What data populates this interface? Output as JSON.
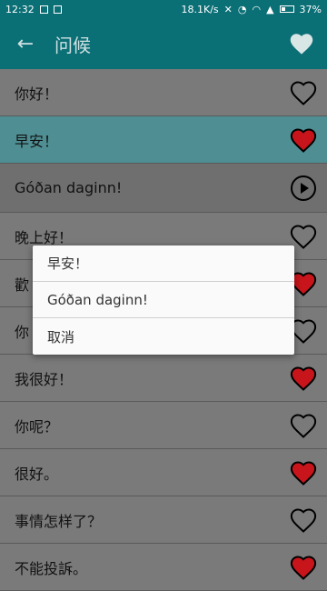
{
  "status": {
    "time": "12:32",
    "speed": "18.1K/s",
    "battery": "37%"
  },
  "appbar": {
    "title": "问候"
  },
  "rows": [
    {
      "text": "你好！",
      "icon": "heart-outline"
    },
    {
      "text": "早安！",
      "icon": "heart-filled"
    },
    {
      "text": "Góðan daginn!",
      "icon": "play-circle"
    },
    {
      "text": "晚上好！",
      "icon": "heart-outline"
    },
    {
      "text": "歡",
      "icon": "heart-filled"
    },
    {
      "text": "你",
      "icon": "heart-outline"
    },
    {
      "text": "我很好！",
      "icon": "heart-filled"
    },
    {
      "text": "你呢？",
      "icon": "heart-outline"
    },
    {
      "text": "很好。",
      "icon": "heart-filled"
    },
    {
      "text": "事情怎样了？",
      "icon": "heart-outline"
    },
    {
      "text": "不能投訴。",
      "icon": "heart-filled"
    }
  ],
  "dialog": {
    "items": [
      "早安！",
      "Góðan daginn!",
      "取消"
    ]
  },
  "colors": {
    "primary": "#0b6f76",
    "heart": "#c8151b",
    "selected_row": "#4f8f93"
  }
}
